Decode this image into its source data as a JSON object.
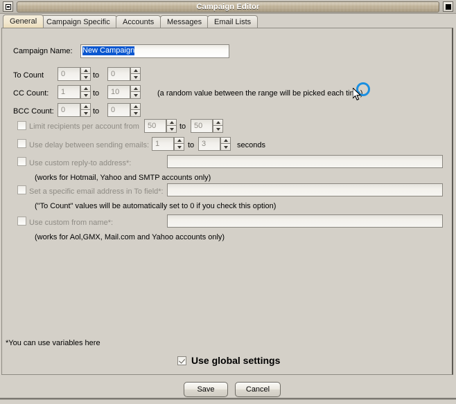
{
  "window": {
    "title": "Campaign Editor",
    "minimize_icon": "minimize-icon",
    "close_icon": "close-icon"
  },
  "tabs": [
    {
      "label": "General",
      "selected": true
    },
    {
      "label": "Campaign Specific",
      "selected": false
    },
    {
      "label": "Accounts",
      "selected": false
    },
    {
      "label": "Messages",
      "selected": false
    },
    {
      "label": "Email Lists",
      "selected": false
    }
  ],
  "form": {
    "campaign_name_label": "Campaign Name:",
    "campaign_name_value": "New Campaign",
    "to_count_label": "To Count",
    "to_count_from": "0",
    "to_count_to": "0",
    "cc_count_label": "CC Count:",
    "cc_count_from": "1",
    "cc_count_to": "10",
    "bcc_count_label": "BCC Count:",
    "bcc_count_from": "0",
    "bcc_count_to": "0",
    "to_word_1": "to",
    "to_word_2": "to",
    "to_word_3": "to",
    "random_note": "(a random value between the range will be picked each time)",
    "limit_label": "Limit recipients per account from",
    "limit_from": "50",
    "limit_to_word": "to",
    "limit_to": "50",
    "delay_label": "Use delay between sending emails:",
    "delay_from": "1",
    "delay_to_word": "to",
    "delay_to": "3",
    "delay_suffix": "seconds",
    "reply_to_label": "Use custom reply-to address*:",
    "reply_to_value": "",
    "reply_to_note": "(works for Hotmail, Yahoo and SMTP accounts only)",
    "to_field_label": "Set a specific email address in To field*:",
    "to_field_value": "",
    "to_field_note": "(\"To Count\" values will be automatically set to 0 if you check this option)",
    "from_name_label": "Use custom from name*:",
    "from_name_value": "",
    "from_name_note": "(works for Aol,GMX, Mail.com and Yahoo accounts only)",
    "variables_note": "*You can use variables here",
    "global_settings_label": "Use global settings"
  },
  "buttons": {
    "save": "Save",
    "cancel": "Cancel"
  },
  "colors": {
    "window_background": "#d4d0c8",
    "titlebar_track": "#a4906a",
    "selection_blue": "#0a57d0",
    "selected_tab": "#f1e7cf",
    "click_indicator": "#1b8fe0",
    "disabled_text": "#8e8b84"
  }
}
